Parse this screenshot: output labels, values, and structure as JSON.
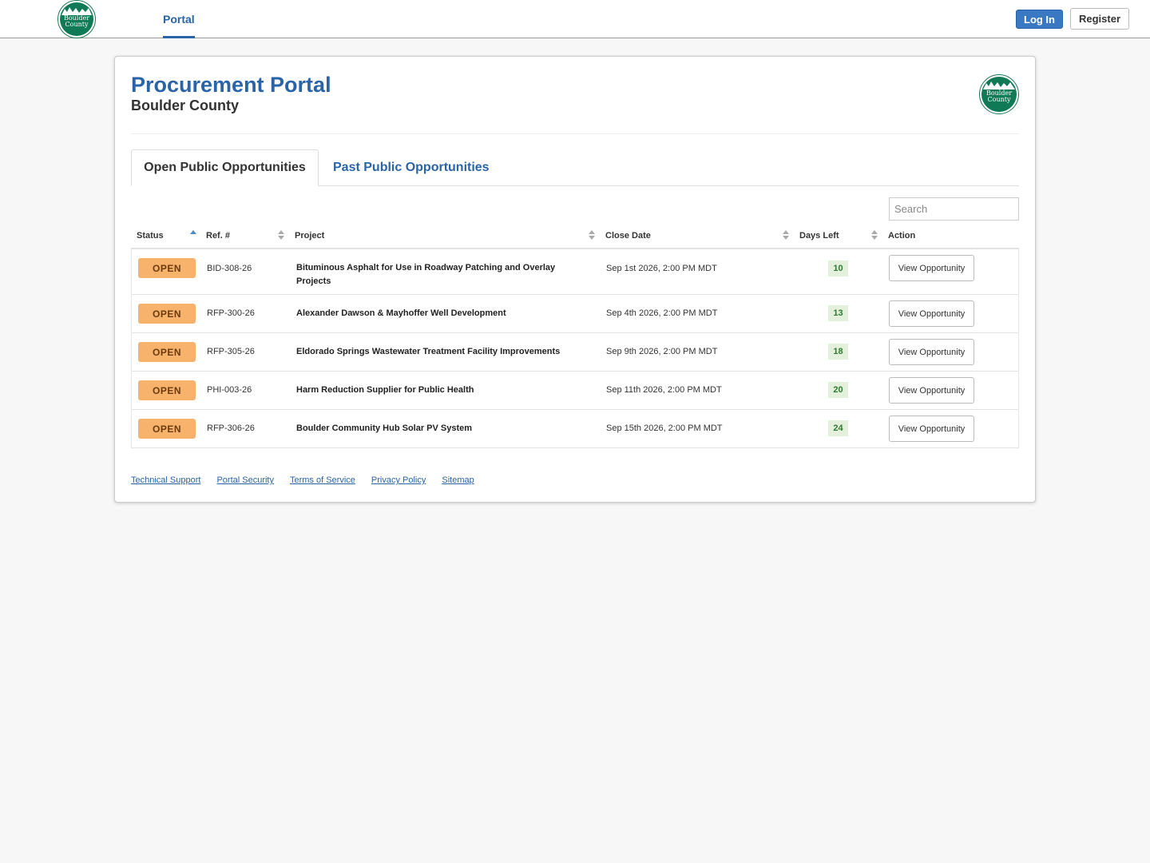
{
  "nav": {
    "logo_text": "Boulder County",
    "portal_tab": "Portal",
    "login_label": "Log In",
    "register_label": "Register"
  },
  "header": {
    "title": "Procurement Portal",
    "subtitle": "Boulder County",
    "logo_line1": "Boulder",
    "logo_line2": "County"
  },
  "tabs": {
    "open": "Open Public Opportunities",
    "past": "Past Public Opportunities"
  },
  "search": {
    "placeholder": "Search"
  },
  "table": {
    "columns": [
      "Status",
      "Ref. #",
      "Project",
      "Close Date",
      "Days Left",
      "Action"
    ],
    "rows": [
      {
        "status": "OPEN",
        "ref": "BID-308-26",
        "project": "Bituminous Asphalt for Use in Roadway Patching and Overlay Projects",
        "close": "Sep 1st 2026, 2:00 PM MDT",
        "days": "10",
        "action": "View Opportunity"
      },
      {
        "status": "OPEN",
        "ref": "RFP-300-26",
        "project": "Alexander Dawson & Mayhoffer Well Development",
        "close": "Sep 4th 2026, 2:00 PM MDT",
        "days": "13",
        "action": "View Opportunity"
      },
      {
        "status": "OPEN",
        "ref": "RFP-305-26",
        "project": "Eldorado Springs Wastewater Treatment Facility Improvements",
        "close": "Sep 9th 2026, 2:00 PM MDT",
        "days": "18",
        "action": "View Opportunity"
      },
      {
        "status": "OPEN",
        "ref": "PHI-003-26",
        "project": "Harm Reduction Supplier for Public Health",
        "close": "Sep 11th 2026, 2:00 PM MDT",
        "days": "20",
        "action": "View Opportunity"
      },
      {
        "status": "OPEN",
        "ref": "RFP-306-26",
        "project": "Boulder Community Hub Solar PV System",
        "close": "Sep 15th 2026, 2:00 PM MDT",
        "days": "24",
        "action": "View Opportunity"
      }
    ]
  },
  "footer": {
    "links": [
      "Technical Support",
      "Portal Security",
      "Terms of Service",
      "Privacy Policy",
      "Sitemap"
    ]
  },
  "colors": {
    "accent": "#2a64a8",
    "open_badge": "#f7b36b",
    "days_badge": "#e3f1dc",
    "logo_green": "#0f7a55"
  }
}
